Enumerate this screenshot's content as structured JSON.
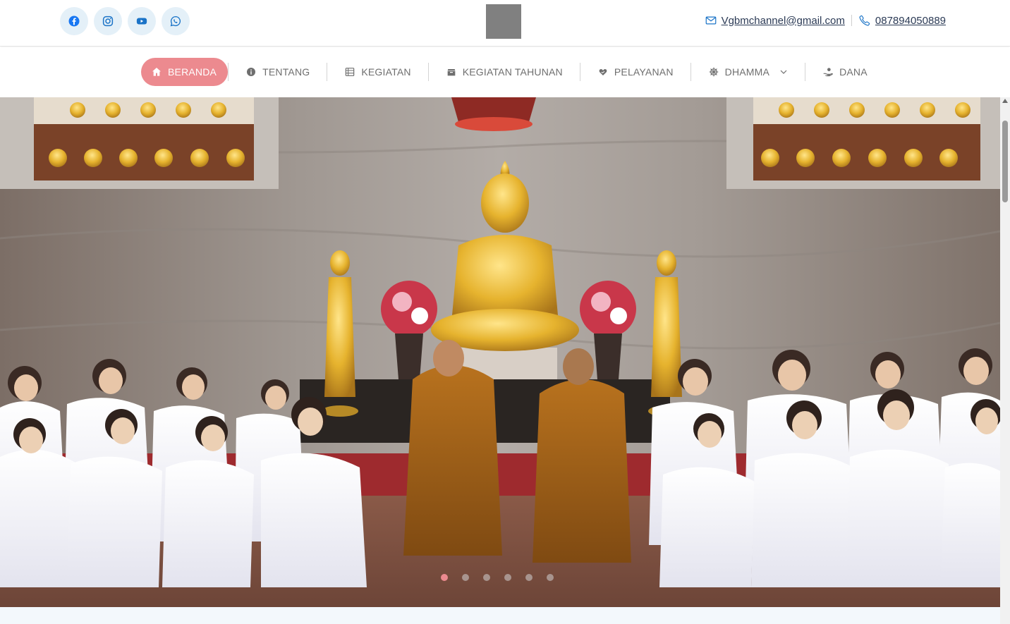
{
  "topbar": {
    "socials": [
      {
        "name": "facebook-icon",
        "color": "#1877f2"
      },
      {
        "name": "instagram-icon",
        "color": "#1a73c7"
      },
      {
        "name": "youtube-icon",
        "color": "#1a73c7"
      },
      {
        "name": "whatsapp-icon",
        "color": "#1a73c7"
      }
    ],
    "email": "Vgbmchannel@gmail.com",
    "phone": "087894050889"
  },
  "nav": {
    "items": [
      {
        "label": "BERANDA",
        "icon": "home-icon",
        "active": true
      },
      {
        "label": "TENTANG",
        "icon": "info-icon"
      },
      {
        "label": "KEGIATAN",
        "icon": "list-icon"
      },
      {
        "label": "KEGIATAN TAHUNAN",
        "icon": "archive-icon"
      },
      {
        "label": "PELAYANAN",
        "icon": "hand-heart-icon"
      },
      {
        "label": "DHAMMA",
        "icon": "dharma-wheel-icon",
        "dropdown": true
      },
      {
        "label": "DANA",
        "icon": "donate-icon"
      }
    ]
  },
  "hero": {
    "slide_count": 6,
    "active_slide": 1,
    "accent_color": "#ec8a8f"
  }
}
